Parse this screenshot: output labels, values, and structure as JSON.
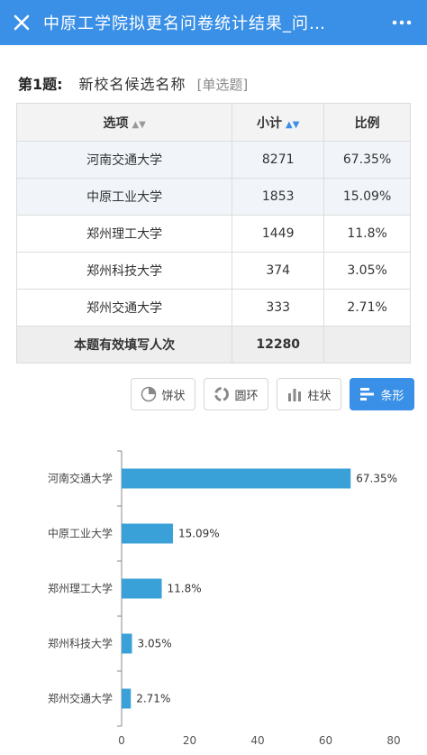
{
  "header": {
    "title": "中原工学院拟更名问卷统计结果_问…",
    "close_icon": "close-icon",
    "more_icon": "more-icon",
    "bg_color": "#3a8fe6"
  },
  "question": {
    "number": "第1题:",
    "text": "新校名候选名称",
    "type": "[单选题]"
  },
  "table": {
    "headers": [
      "选项",
      "小计",
      "比例"
    ],
    "rows": [
      {
        "option": "河南交通大学",
        "count": "8271",
        "ratio": "67.35%"
      },
      {
        "option": "中原工业大学",
        "count": "1853",
        "ratio": "15.09%"
      },
      {
        "option": "郑州理工大学",
        "count": "1449",
        "ratio": "11.8%"
      },
      {
        "option": "郑州科技大学",
        "count": "374",
        "ratio": "3.05%"
      },
      {
        "option": "郑州交通大学",
        "count": "333",
        "ratio": "2.71%"
      }
    ],
    "total_label": "本题有效填写人次",
    "total_value": "12280"
  },
  "chart_tabs": [
    {
      "label": "饼状",
      "icon": "pie-chart-icon",
      "active": false
    },
    {
      "label": "圆环",
      "icon": "donut-chart-icon",
      "active": false
    },
    {
      "label": "柱状",
      "icon": "column-chart-icon",
      "active": false
    },
    {
      "label": "条形",
      "icon": "bar-chart-icon",
      "active": true
    }
  ],
  "chart_data": {
    "type": "bar",
    "orientation": "horizontal",
    "categories": [
      "河南交通大学",
      "中原工业大学",
      "郑州理工大学",
      "郑州科技大学",
      "郑州交通大学"
    ],
    "values": [
      67.35,
      15.09,
      11.8,
      3.05,
      2.71
    ],
    "value_labels": [
      "67.35%",
      "15.09%",
      "11.8%",
      "3.05%",
      "2.71%"
    ],
    "xlim": [
      0,
      80
    ],
    "xticks": [
      0,
      20,
      40,
      60,
      80
    ],
    "bar_color": "#3aa0d8",
    "grid": false
  }
}
